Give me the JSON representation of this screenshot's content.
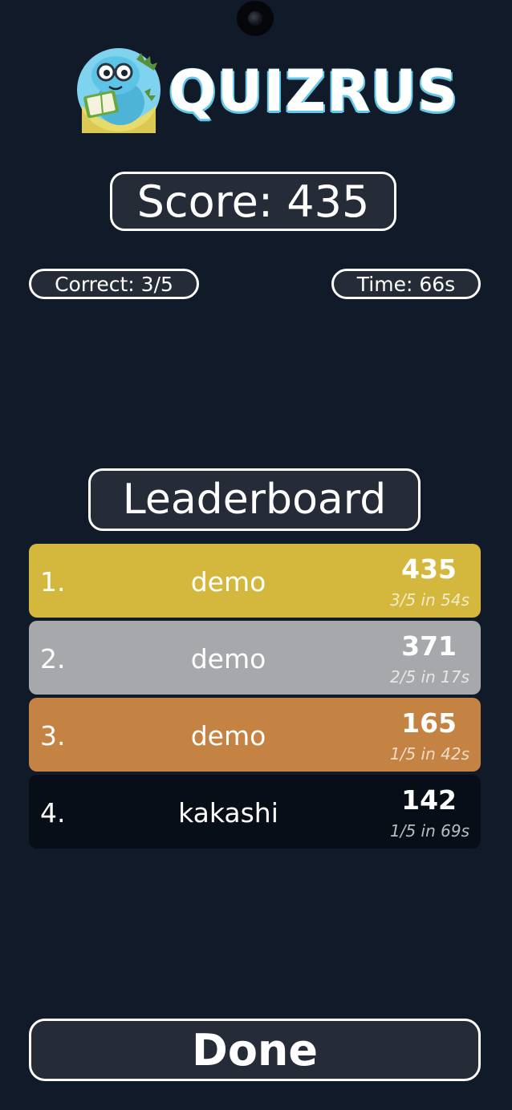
{
  "app": {
    "logo_text": "QUIZRUS",
    "logo_mascot": "dinosaur-reading-book"
  },
  "result": {
    "score_text": "Score: 435",
    "correct_text": "Correct: 3/5",
    "time_text": "Time: 66s"
  },
  "leaderboard": {
    "title": "Leaderboard",
    "entries": [
      {
        "rank": "1.",
        "name": "demo",
        "score": "435",
        "detail": "3/5 in 54s",
        "medal": "gold",
        "color": "#d3b83d"
      },
      {
        "rank": "2.",
        "name": "demo",
        "score": "371",
        "detail": "2/5 in 17s",
        "medal": "silver",
        "color": "#a6a8ab"
      },
      {
        "rank": "3.",
        "name": "demo",
        "score": "165",
        "detail": "1/5 in 42s",
        "medal": "bronze",
        "color": "#c48243"
      },
      {
        "rank": "4.",
        "name": "kakashi",
        "score": "142",
        "detail": "1/5 in 69s",
        "medal": "none",
        "color": "#080e18"
      }
    ]
  },
  "actions": {
    "done_label": "Done"
  },
  "colors": {
    "background": "#111a28",
    "panel": "#252c37",
    "border": "#ffffff",
    "logo_accent": "#5fc7ea"
  }
}
